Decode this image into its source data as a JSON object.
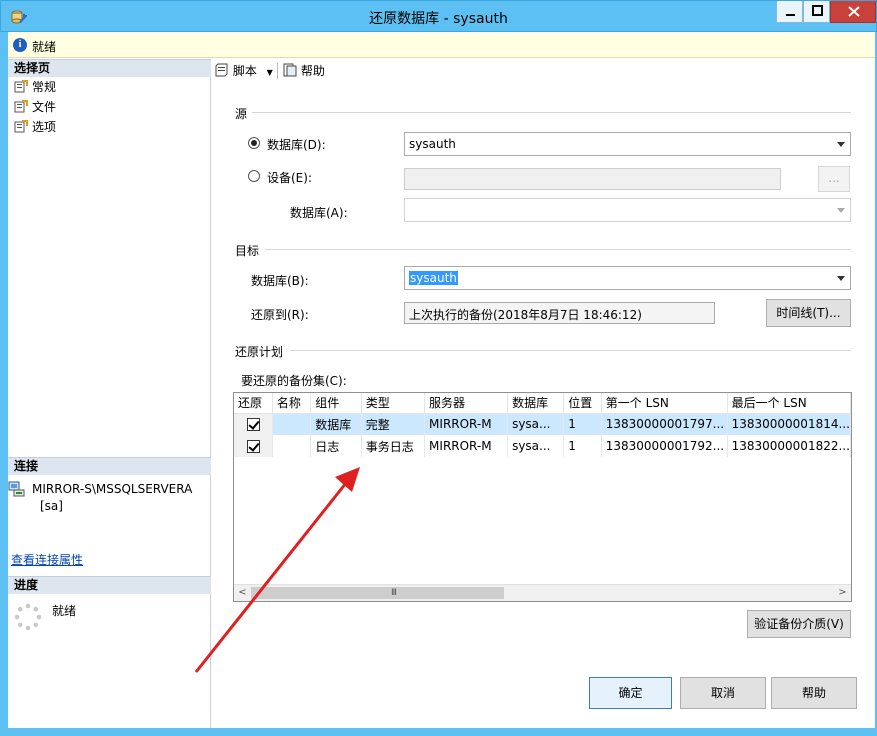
{
  "window": {
    "title": "还原数据库 - sysauth",
    "app_icon": "database-restore-icon",
    "border_color": "#5cc1f2",
    "close_color": "#c8413a"
  },
  "infobar": {
    "icon": "info-icon",
    "text": "就绪",
    "background": "#ffffe1"
  },
  "left_pane": {
    "select_page_header": "选择页",
    "pages": [
      {
        "label": "常规",
        "icon": "page-icon"
      },
      {
        "label": "文件",
        "icon": "page-icon"
      },
      {
        "label": "选项",
        "icon": "page-icon"
      }
    ],
    "connection_header": "连接",
    "connection_server": "MIRROR-S\\MSSQLSERVERA",
    "connection_user": "[sa]",
    "view_connection_properties": "查看连接属性",
    "progress_header": "进度",
    "progress_status": "就绪"
  },
  "toolbar": {
    "script_label": "脚本",
    "help_label": "帮助"
  },
  "source": {
    "group_title": "源",
    "database_radio_label": "数据库(D):",
    "database_value": "sysauth",
    "device_radio_label": "设备(E):",
    "device_value": "",
    "browse_label": "...",
    "device_database_label": "数据库(A):",
    "device_database_value": ""
  },
  "destination": {
    "group_title": "目标",
    "database_label": "数据库(B):",
    "database_value": "sysauth",
    "restore_to_label": "还原到(R):",
    "restore_to_value": "上次执行的备份(2018年8月7日 18:46:12)",
    "timeline_button": "时间线(T)..."
  },
  "restore_plan": {
    "group_title": "还原计划",
    "backup_sets_label": "要还原的备份集(C):",
    "columns": [
      "还原",
      "名称",
      "组件",
      "类型",
      "服务器",
      "数据库",
      "位置",
      "第一个 LSN",
      "最后一个 LSN"
    ],
    "rows": [
      {
        "restore": true,
        "name": "",
        "component": "数据库",
        "type": "完整",
        "server": "MIRROR-M",
        "database": "sysa...",
        "position": "1",
        "first_lsn": "13830000001797...",
        "last_lsn": "13830000001814...",
        "selected": true
      },
      {
        "restore": true,
        "name": "",
        "component": "日志",
        "type": "事务日志",
        "server": "MIRROR-M",
        "database": "sysa...",
        "position": "1",
        "first_lsn": "13830000001792...",
        "last_lsn": "13830000001822...",
        "selected": false
      }
    ],
    "scroll_grip": "III",
    "verify_button": "验证备份介质(V)"
  },
  "buttons": {
    "ok": "确定",
    "cancel": "取消",
    "help": "帮助"
  },
  "annotation": {
    "color": "#e02020"
  }
}
